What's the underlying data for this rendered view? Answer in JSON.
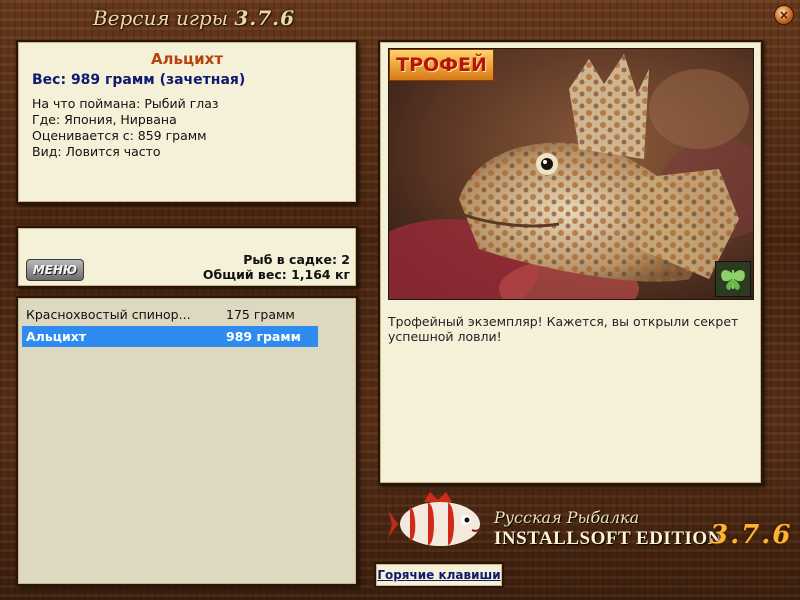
{
  "window": {
    "title": "Версия игры",
    "version": "3.7.6"
  },
  "fish": {
    "name": "Альцихт",
    "weight_line": "Вес: 989 грамм (зачетная)",
    "details": [
      "На что поймана: Рыбий глаз",
      "Где: Япония, Нирвана",
      "Оценивается с: 859 грамм",
      "Вид: Ловится часто"
    ]
  },
  "menu": {
    "label": "МЕНЮ"
  },
  "summary": {
    "fish_in_net": "Рыб в садке: 2",
    "total_weight": "Общий вес: 1,164 кг"
  },
  "catch_list": [
    {
      "name": "Краснохвостый спинор...",
      "weight": "175 грамм",
      "selected": false
    },
    {
      "name": "Альцихт",
      "weight": "989 грамм",
      "selected": true
    }
  ],
  "trophy": {
    "badge": "ТРОФЕЙ",
    "text": "Трофейный экземпляр! Кажется, вы открыли секрет успешной ловли!"
  },
  "brand": {
    "line1": "Русская Рыбалка",
    "line2": "INSTALLSOFT EDITION",
    "version": "3.7.6"
  },
  "hotkeys": {
    "label": "Горячие клавиши"
  },
  "colors": {
    "selection": "#2e8cf0",
    "fish_name": "#b8420e",
    "weight": "#101a6e",
    "panel": "#f5f0d8"
  }
}
